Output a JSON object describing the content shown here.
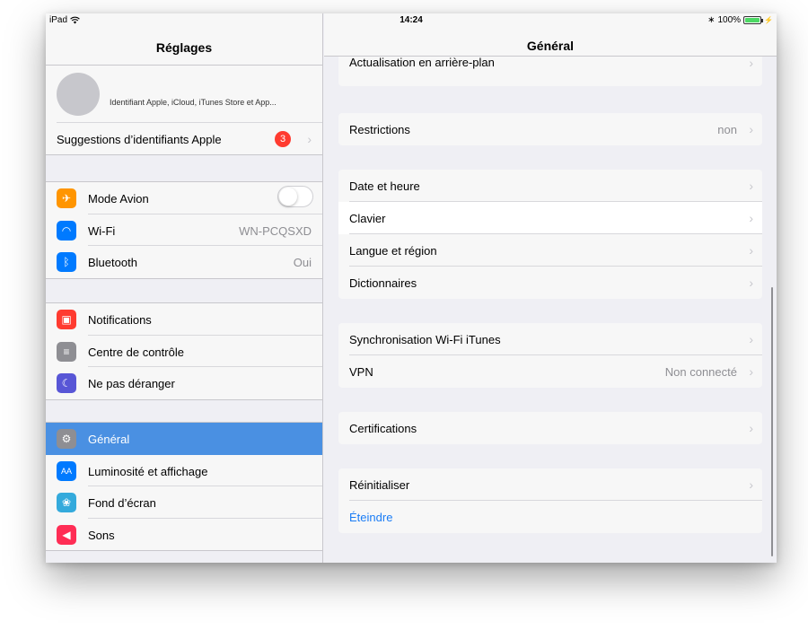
{
  "status": {
    "device": "iPad",
    "time": "14:24",
    "battery": "100%",
    "battery_level": 1.0
  },
  "sidebar": {
    "title": "Réglages",
    "profile_subtitle": "Identifiant Apple, iCloud, iTunes Store et App...",
    "suggestions": {
      "label": "Suggestions d’identifiants Apple",
      "badge": "3"
    },
    "connectivity": [
      {
        "label": "Mode Avion",
        "icon": "airplane-icon",
        "color": "#ff9500",
        "toggle": false
      },
      {
        "label": "Wi-Fi",
        "icon": "wifi-icon",
        "color": "#007aff",
        "value": "WN-PCQSXD"
      },
      {
        "label": "Bluetooth",
        "icon": "bluetooth-icon",
        "color": "#007aff",
        "value": "Oui"
      }
    ],
    "system": [
      {
        "label": "Notifications",
        "icon": "notifications-icon",
        "color": "#ff3b30"
      },
      {
        "label": "Centre de contrôle",
        "icon": "control-center-icon",
        "color": "#8e8e93"
      },
      {
        "label": "Ne pas déranger",
        "icon": "moon-icon",
        "color": "#5856d6"
      }
    ],
    "display": [
      {
        "label": "Général",
        "icon": "gear-icon",
        "color": "#8e8e93",
        "selected": true
      },
      {
        "label": "Luminosité et affichage",
        "icon": "brightness-icon",
        "color": "#007aff"
      },
      {
        "label": "Fond d’écran",
        "icon": "wallpaper-icon",
        "color": "#34aadc"
      },
      {
        "label": "Sons",
        "icon": "sound-icon",
        "color": "#ff2d55"
      }
    ]
  },
  "detail": {
    "title": "Général",
    "groups": [
      [
        {
          "label": "Actualisation en arrière-plan"
        }
      ],
      [
        {
          "label": "Restrictions",
          "value": "non"
        }
      ],
      [
        {
          "label": "Date et heure"
        },
        {
          "label": "Clavier",
          "highlight": true
        },
        {
          "label": "Langue et région"
        },
        {
          "label": "Dictionnaires"
        }
      ],
      [
        {
          "label": "Synchronisation Wi-Fi iTunes"
        },
        {
          "label": "VPN",
          "value": "Non connecté"
        }
      ],
      [
        {
          "label": "Certifications"
        }
      ],
      [
        {
          "label": "Réinitialiser"
        },
        {
          "label": "Éteindre",
          "action": true
        }
      ]
    ]
  }
}
